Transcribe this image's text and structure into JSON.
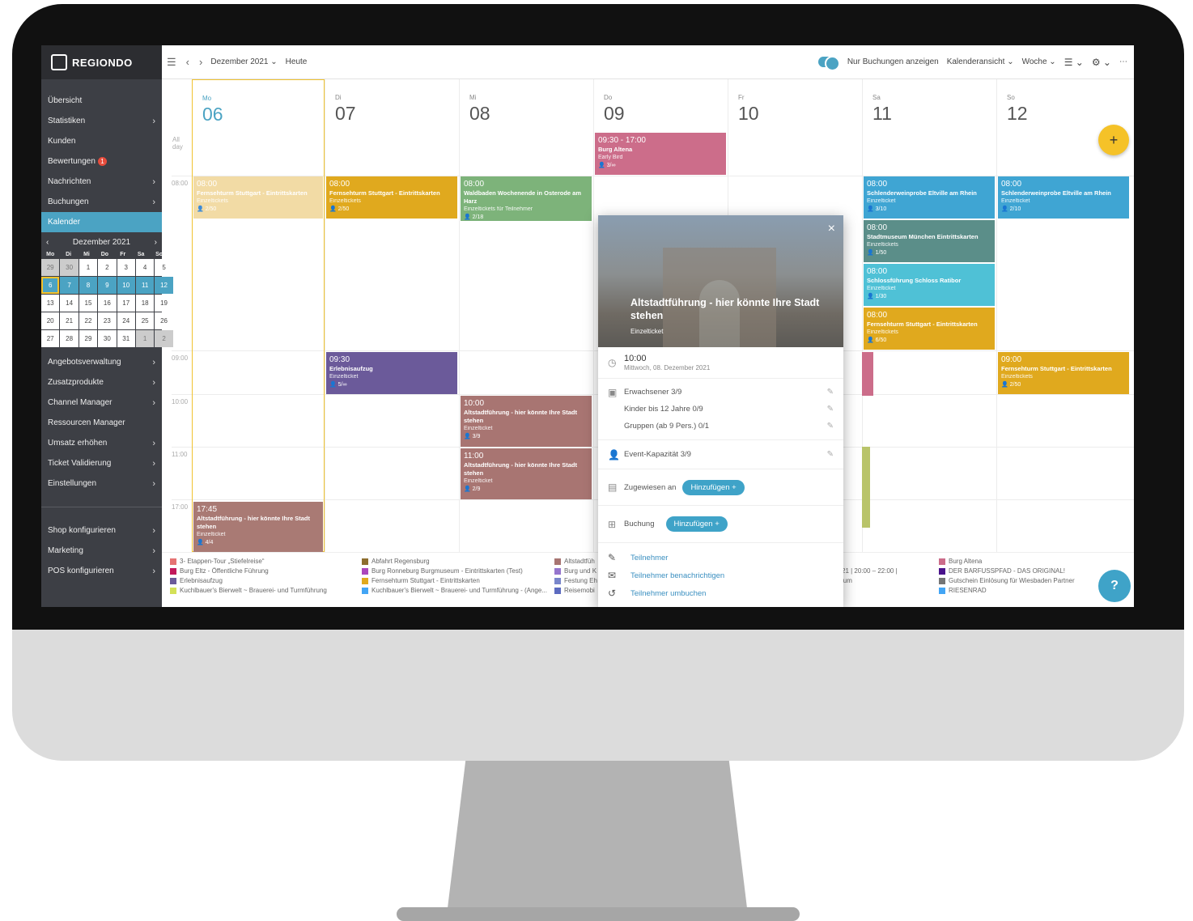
{
  "brand": "REGIONDO",
  "sidebar": {
    "items": [
      {
        "label": "Übersicht",
        "chev": ""
      },
      {
        "label": "Statistiken",
        "chev": "›"
      },
      {
        "label": "Kunden",
        "chev": ""
      },
      {
        "label": "Bewertungen",
        "chev": "",
        "badge": "1"
      },
      {
        "label": "Nachrichten",
        "chev": "›"
      },
      {
        "label": "Buchungen",
        "chev": "›"
      },
      {
        "label": "Kalender",
        "chev": ""
      }
    ],
    "items2": [
      {
        "label": "Angebotsverwaltung",
        "chev": "›"
      },
      {
        "label": "Zusatzprodukte",
        "chev": "›"
      },
      {
        "label": "Channel Manager",
        "chev": "›"
      },
      {
        "label": "Ressourcen Manager",
        "chev": ""
      },
      {
        "label": "Umsatz erhöhen",
        "chev": "›"
      },
      {
        "label": "Ticket Validierung",
        "chev": "›"
      },
      {
        "label": "Einstellungen",
        "chev": "›"
      }
    ],
    "items3": [
      {
        "label": "Shop konfigurieren",
        "chev": "›"
      },
      {
        "label": "Marketing",
        "chev": "›"
      },
      {
        "label": "POS konfigurieren",
        "chev": "›"
      }
    ]
  },
  "minical": {
    "month": "Dezember 2021",
    "prev": "‹",
    "next": "›",
    "weekdays": [
      "Mo",
      "Di",
      "Mi",
      "Do",
      "Fr",
      "Sa",
      "So"
    ],
    "cells": [
      "29",
      "30",
      "1",
      "2",
      "3",
      "4",
      "5",
      "6",
      "7",
      "8",
      "9",
      "10",
      "11",
      "12",
      "13",
      "14",
      "15",
      "16",
      "17",
      "18",
      "19",
      "20",
      "21",
      "22",
      "23",
      "24",
      "25",
      "26",
      "27",
      "28",
      "29",
      "30",
      "31",
      "1",
      "2"
    ]
  },
  "topbar": {
    "menu": "☰",
    "prev": "‹",
    "next": "›",
    "period": "Dezember 2021 ⌄",
    "today": "Heute",
    "only_bookings": "Nur Buchungen anzeigen",
    "view": "Kalenderansicht ⌄",
    "range": "Woche ⌄",
    "filter": "☰ ⌄",
    "settings": "⚙ ⌄",
    "more": "⋯"
  },
  "days": [
    {
      "dn": "Mo",
      "dd": "06"
    },
    {
      "dn": "Di",
      "dd": "07"
    },
    {
      "dn": "Mi",
      "dd": "08"
    },
    {
      "dn": "Do",
      "dd": "09"
    },
    {
      "dn": "Fr",
      "dd": "10"
    },
    {
      "dn": "Sa",
      "dd": "11"
    },
    {
      "dn": "So",
      "dd": "12"
    }
  ],
  "times": {
    "allday": "All day",
    "t0800": "08:00",
    "t0900": "09:00",
    "t1000": "10:00",
    "t1100": "11:00",
    "t1700": "17:00"
  },
  "events": [
    {
      "t": "08:00",
      "n": "Fernsehturm Stuttgart - Eintrittskarten",
      "s": "Einzeltickets",
      "c": "👤 2/50",
      "color": "#f0d596"
    },
    {
      "t": "17:45",
      "n": "Altstadtführung - hier könnte Ihre Stadt stehen",
      "s": "Einzelticket",
      "c": "👤 4/4",
      "color": "#a97a74"
    },
    {
      "t": "08:00",
      "n": "Fernsehturm Stuttgart - Eintrittskarten",
      "s": "Einzeltickets",
      "c": "👤 2/50",
      "color": "#e0a91e"
    },
    {
      "t": "09:30",
      "n": "Erlebnisaufzug",
      "s": "Einzelticket",
      "c": "👤 5/∞",
      "color": "#6b5a9a"
    },
    {
      "t": "08:00",
      "n": "Waldbaden Wochenende in Osterode am Harz",
      "s": "Einzeltickets für Teilnehmer",
      "c": "👤 2/18",
      "color": "#7db37a"
    },
    {
      "t": "10:00",
      "n": "Altstadtführung - hier könnte Ihre Stadt stehen",
      "s": "Einzelticket",
      "c": "👤 3/9",
      "color": "#a87572"
    },
    {
      "t": "11:00",
      "n": "Altstadtführung - hier könnte Ihre Stadt stehen",
      "s": "Einzelticket",
      "c": "👤 2/9",
      "color": "#a87572"
    },
    {
      "t": "09:30 - 17:00",
      "n": "Burg Altena",
      "s": "Early Bird",
      "c": "👤 3/∞",
      "color": "#cc6d8a"
    },
    {
      "t": "08:00",
      "n": "Schlenderweinprobe Eltville am Rhein",
      "s": "Einzelticket",
      "c": "👤 3/10",
      "color": "#3fa5d3"
    },
    {
      "t": "08:00",
      "n": "Stadtmuseum München Eintrittskarten",
      "s": "Einzeltickets",
      "c": "👤 1/50",
      "color": "#5b8e89"
    },
    {
      "t": "08:00",
      "n": "Schlossführung Schloss Ratibor",
      "s": "Einzelticket",
      "c": "👤 1/30",
      "color": "#4fc1d6"
    },
    {
      "t": "08:00",
      "n": "Fernsehturm Stuttgart - Eintrittskarten",
      "s": "Einzeltickets",
      "c": "👤 6/50",
      "color": "#e0a91e"
    },
    {
      "t": "08:00",
      "n": "Schlenderweinprobe Eltville am Rhein",
      "s": "Einzelticket",
      "c": "👤 2/10",
      "color": "#3fa5d3"
    },
    {
      "t": "09:00",
      "n": "Fernsehturm Stuttgart - Eintrittskarten",
      "s": "Einzeltickets",
      "c": "👤 2/50",
      "color": "#e0a91e"
    }
  ],
  "legend": [
    {
      "label": "3- Etappen-Tour „Stiefelreise“",
      "color": "#e57373"
    },
    {
      "label": "Burg Eltz - Öffentliche Führung",
      "color": "#c2185b"
    },
    {
      "label": "Erlebnisaufzug",
      "color": "#6b5a9a"
    },
    {
      "label": "Kuchlbauer's Bierwelt ~ Brauerei- und Turmführung",
      "color": "#d4e157"
    },
    {
      "label": "Abfahrt Regensburg",
      "color": "#8d6e2f"
    },
    {
      "label": "Burg Ronneburg Burgmuseum - Eintrittskarten (Test)",
      "color": "#ab47bc"
    },
    {
      "label": "Fernsehturm Stuttgart - Eintrittskarten",
      "color": "#e0a91e"
    },
    {
      "label": "Kuchlbauer's Bierwelt ~ Brauerei- und Turmführung - (Ange...",
      "color": "#42a5f5"
    },
    {
      "label": "Altstadtfüh",
      "color": "#a87572"
    },
    {
      "label": "Burg und K",
      "color": "#9575cd"
    },
    {
      "label": "Festung Eh",
      "color": "#7986cb"
    },
    {
      "label": "Reisemobi",
      "color": "#5c6bc0"
    },
    {
      "label": "21 | 20:00 – 22:00 |",
      "color": ""
    },
    {
      "label": "lum",
      "color": ""
    },
    {
      "label": "Burg Altena",
      "color": "#cc6d8a"
    },
    {
      "label": "DER BARFUSSPFAD - DAS ORIGINAL!",
      "color": "#4a148c"
    },
    {
      "label": "Gutschein Einlösung für Wiesbaden Partner",
      "color": "#757575"
    },
    {
      "label": "RIESENRAD",
      "color": "#42a5f5"
    }
  ],
  "fab": "+",
  "help": "?",
  "popup": {
    "close": "×",
    "title": "Altstadtführung - hier könnte Ihre Stadt stehen",
    "subtitle": "Einzelticket",
    "time": "10:00",
    "date": "Mittwoch, 08. Dezember 2021",
    "tickets": [
      "Erwachsener 3/9",
      "Kinder bis 12 Jahre 0/9",
      "Gruppen (ab 9 Pers.) 0/1"
    ],
    "capacity": "Event-Kapazität 3/9",
    "assigned": "Zugewiesen an",
    "booking": "Buchung",
    "add": "Hinzufügen  +",
    "links": [
      "Teilnehmer",
      "Teilnehmer benachrichtigen",
      "Teilnehmer umbuchen"
    ]
  }
}
